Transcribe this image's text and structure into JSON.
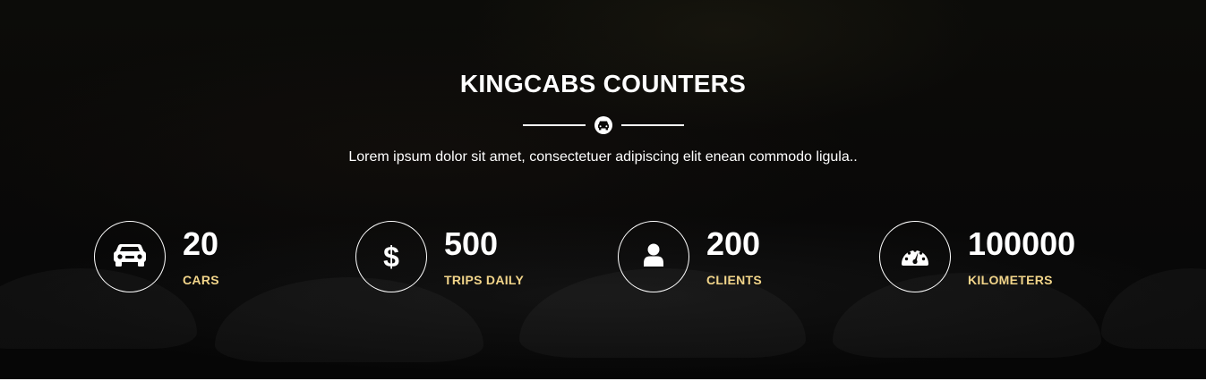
{
  "section": {
    "title": "KINGCABS COUNTERS",
    "divider_icon": "car-front-icon",
    "subtitle": "Lorem ipsum dolor sit amet, consectetuer adipiscing elit enean commodo ligula.."
  },
  "counters": [
    {
      "icon": "car-icon",
      "number": "20",
      "label": "CARS"
    },
    {
      "icon": "dollar-icon",
      "number": "500",
      "label": "TRIPS DAILY"
    },
    {
      "icon": "user-icon",
      "number": "200",
      "label": "CLIENTS"
    },
    {
      "icon": "speedometer-icon",
      "number": "100000",
      "label": "KILOMETERS"
    }
  ],
  "colors": {
    "background": "#0a0908",
    "text": "#ffffff",
    "accent_label": "#f2d58a"
  }
}
